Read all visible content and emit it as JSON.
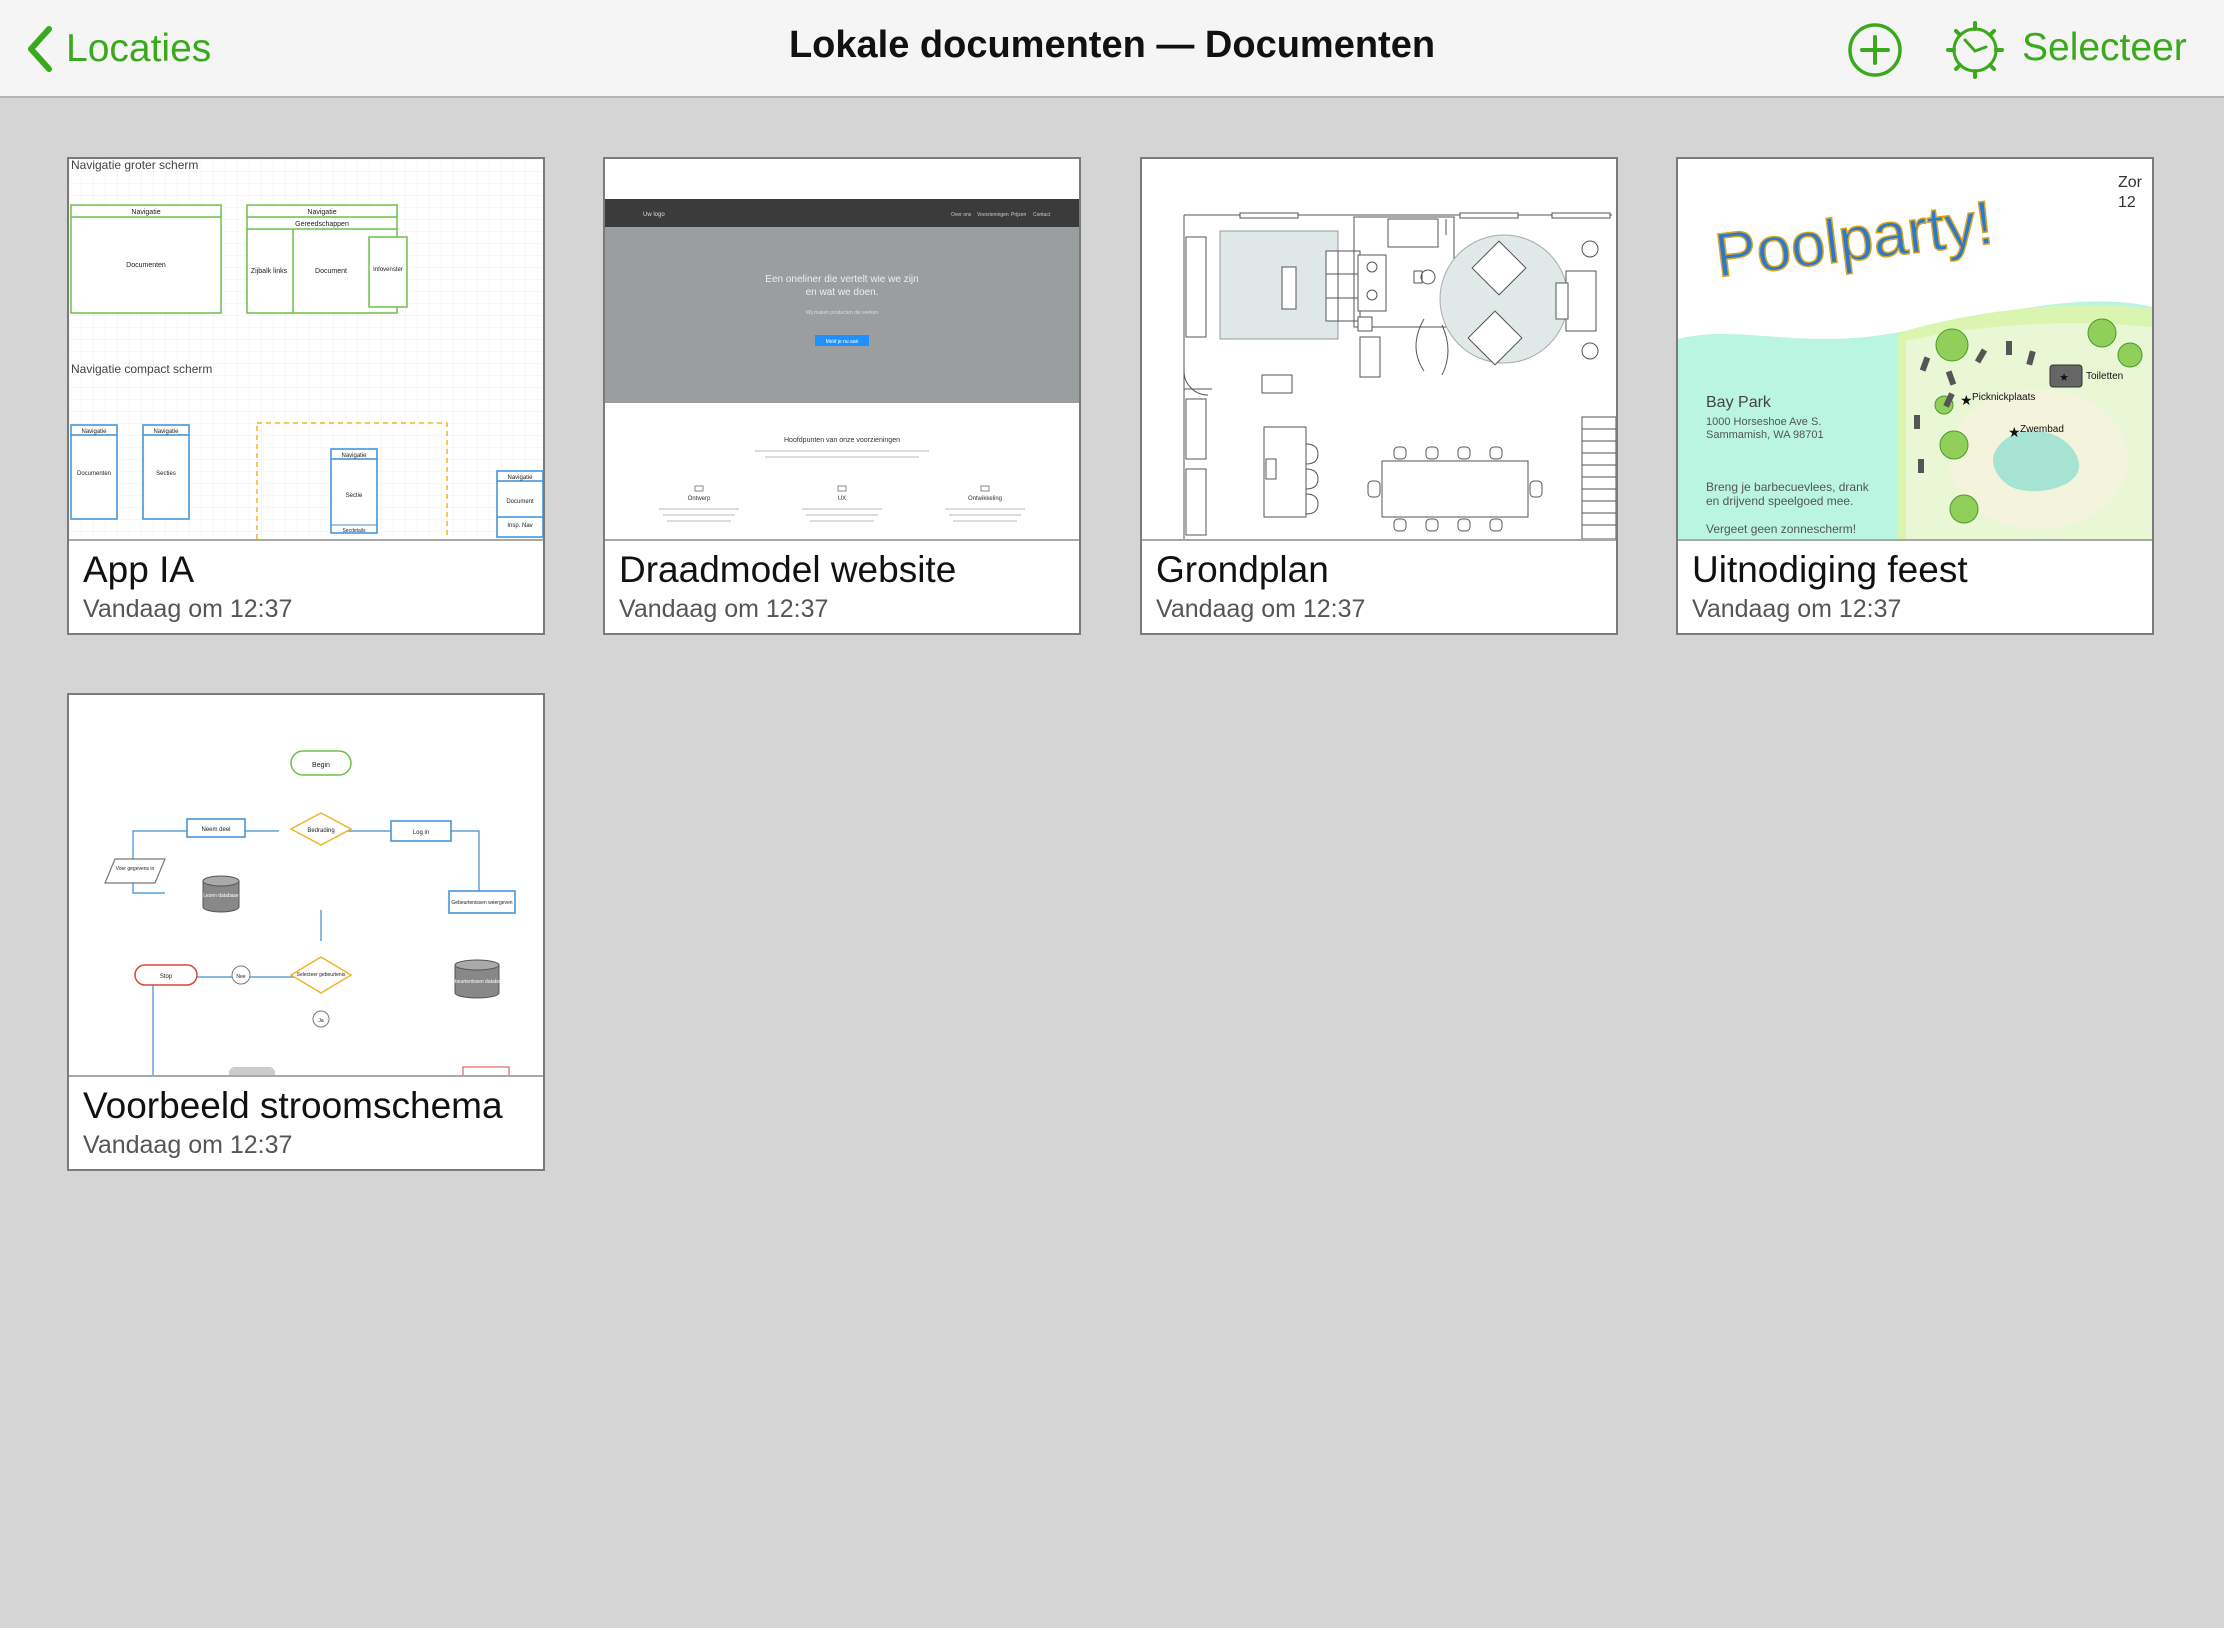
{
  "navbar": {
    "back_label": "Locaties",
    "title": "Lokale documenten — Documenten",
    "select_label": "Selecteer",
    "accent_color": "#3aaa1c",
    "icons": {
      "back": "chevron-left-icon",
      "add": "plus-circle-icon",
      "settings": "gear-icon"
    }
  },
  "documents": [
    {
      "title": "App IA",
      "date": "Vandaag om 12:37",
      "thumb": {
        "heading_large": "Navigatie groter scherm",
        "heading_compact": "Navigatie compact scherm",
        "nav1": "Navigatie",
        "doc1": "Documenten",
        "nav2": "Navigatie",
        "tools": "Gereedschappen",
        "sidebar": "Zijbalk links",
        "doc2": "Document",
        "inspector": "Infovenster",
        "c_nav1": "Navigatie",
        "c_doc": "Documenten",
        "c_nav2": "Navigatie",
        "c_sec": "Secties",
        "c_nav3": "Navigatie",
        "c_sec2": "Sectie",
        "c_detail": "Secdetails",
        "c_nav4": "Navigatie",
        "c_doc2": "Document",
        "c_insp": "Insp. Nav"
      }
    },
    {
      "title": "Draadmodel website",
      "date": "Vandaag om 12:37",
      "thumb": {
        "brand": "Uw logo",
        "menu": [
          "Over ons",
          "Voorzieningen",
          "Prijzen",
          "Contact"
        ],
        "hero_line1": "Een oneliner die vertelt wie we zijn",
        "hero_line2": "en wat we doen.",
        "hero_sub": "Wij maken producten die werken",
        "hero_button": "Meld je nu aan",
        "section_title": "Hoofdpunten van onze voorzieningen",
        "features": [
          "Ontwerp",
          "UX",
          "Ontwikkeling"
        ]
      }
    },
    {
      "title": "Grondplan",
      "date": "Vandaag om 12:37",
      "thumb": {}
    },
    {
      "title": "Uitnodiging feest",
      "date": "Vandaag om 12:37",
      "thumb": {
        "headline": "Poolparty!",
        "corner_line1": "Zor",
        "corner_line2": "12",
        "venue": "Bay Park",
        "address1": "1000 Horseshoe Ave S.",
        "address2": "Sammamish, WA 98701",
        "note1": "Breng je barbecuevlees, drank",
        "note2": "en drijvend speelgoed mee.",
        "note3": "Vergeet geen zonnescherm!",
        "poi_picnic": "Picknickplaats",
        "poi_toilets": "Toiletten",
        "poi_pool": "Zwembad"
      }
    },
    {
      "title": "Voorbeeld stroomschema",
      "date": "Vandaag om 12:37",
      "thumb": {
        "start": "Begin",
        "take_part": "Neem deel",
        "condition": "Bedrading",
        "login": "Log in",
        "enter": "Voer gegevens in",
        "read_db": "Lezen database",
        "show_events": "Gebeurtenissen weergeven",
        "stop": "Stop",
        "no": "Nee",
        "select_event": "Selecteer gebeurtenis",
        "yes": "Ja",
        "store": "Gebeurtenissen database"
      }
    }
  ]
}
